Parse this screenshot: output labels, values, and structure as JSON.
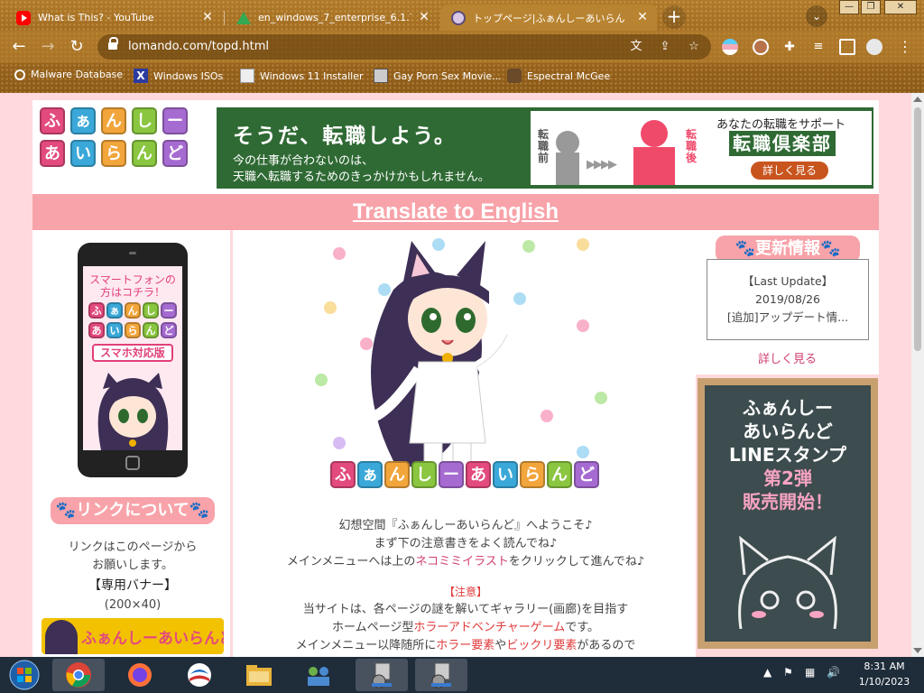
{
  "browser": {
    "tabs": [
      {
        "title": "What is This? - YouTube",
        "favicon": "youtube-icon"
      },
      {
        "title": "en_windows_7_enterprise_6.1.7",
        "favicon": "google-drive-icon"
      },
      {
        "title": "トップページ|ふぁんしーあいらんど",
        "favicon": "cat-girl-icon"
      }
    ],
    "url": "lomando.com/topd.html",
    "bookmarks": [
      {
        "label": "Malware Database"
      },
      {
        "label": "Windows ISOs"
      },
      {
        "label": "Windows 11 Installer"
      },
      {
        "label": "Gay Porn Sex Movie..."
      },
      {
        "label": "Espectral McGee"
      }
    ]
  },
  "site": {
    "logo": {
      "row1": [
        "ふ",
        "ぁ",
        "ん",
        "し",
        "ー"
      ],
      "row2": [
        "あ",
        "い",
        "ら",
        "ん",
        "ど"
      ]
    },
    "ad": {
      "headline": "そうだ、転職しよう。",
      "line1": "今の仕事が合わないのは、",
      "line2": "天職へ転職するためのきっかけかもしれません。",
      "before": "転職前",
      "after": "転職後",
      "arrows": "▶▶▶▶",
      "subtitle": "あなたの転職をサポート",
      "club": "転職倶楽部",
      "more": "詳しく見る"
    },
    "translate_link": "Translate to English",
    "phone": {
      "title_line1": "スマートフォンの",
      "title_line2": "方はコチラ！",
      "logo_row1": [
        "ふ",
        "ぁ",
        "ん",
        "し",
        "ー"
      ],
      "logo_row2": [
        "あ",
        "い",
        "ら",
        "ん",
        "ど"
      ],
      "badge": "スマホ対応版"
    },
    "link_heading": "リンクについて",
    "link_text1": "リンクはこのページから",
    "link_text2": "お願いします。",
    "banner_label": "【専用バナー】",
    "banner_size": "(200×40)",
    "banner_text": "ふぁんしーあいらんど",
    "main_logo": [
      "ふ",
      "ぁ",
      "ん",
      "し",
      "ー",
      "あ",
      "い",
      "ら",
      "ん",
      "ど"
    ],
    "welcome": {
      "line1": "幻想空間『ふぁんしーあいらんど』へようこそ♪",
      "line2": "まず下の注意書きをよく読んでね♪",
      "line3_pre": "メインメニューへは上の",
      "line3_link": "ネコミミイラスト",
      "line3_post": "をクリックして進んでね♪"
    },
    "notice": {
      "heading": "【注意】",
      "line1": "当サイトは、各ページの謎を解いてギャラリー(画廊)を目指す",
      "line2_pre": "ホームページ型",
      "line2_link": "ホラーアドベンチャーゲーム",
      "line2_post": "です。",
      "line3_pre": "メインメニュー以降随所に",
      "line3_link1": "ホラー要素",
      "line3_mid": "や",
      "line3_link2": "ビックリ要素",
      "line3_post": "があるので"
    },
    "update_heading": "更新情報",
    "update": {
      "label": "【Last Update】",
      "date": "2019/08/26",
      "text": "[追加]アップデート情..."
    },
    "update_more": "詳しく見る",
    "line_stamp": {
      "line1": "ふぁんしー",
      "line2": "あいらんど",
      "line3": "LINEスタンプ",
      "line4": "第2弾",
      "line5": "販売開始！"
    }
  },
  "taskbar": {
    "time": "8:31 AM",
    "date": "1/10/2023"
  },
  "colors": {
    "pink": "#f7a3a9",
    "page_bg": "#ffd9dc",
    "link_red": "#e03a3a"
  }
}
